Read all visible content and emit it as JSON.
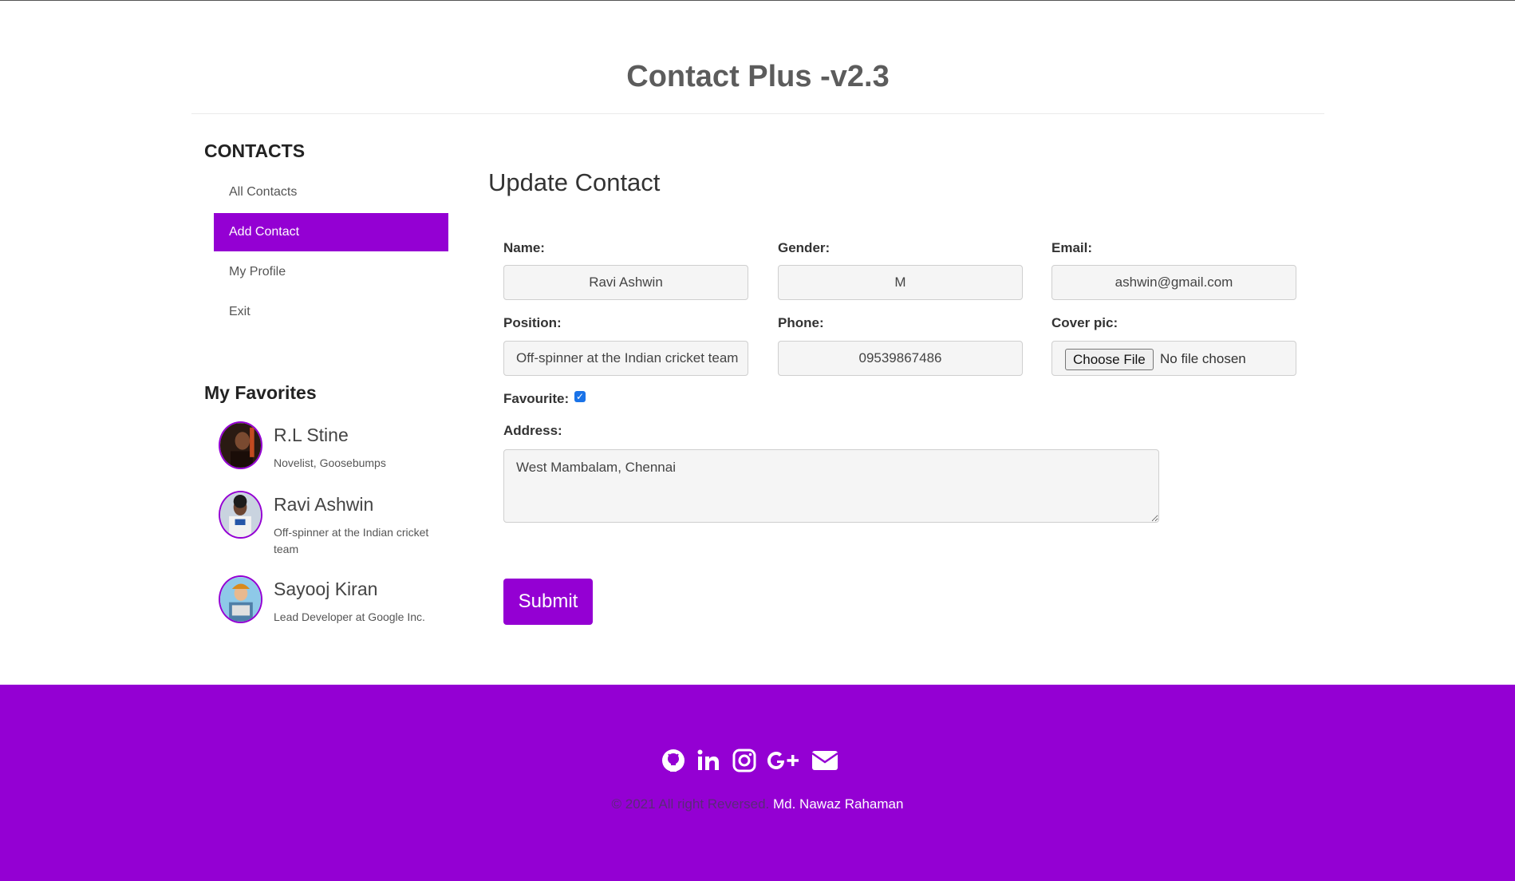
{
  "header": {
    "title": "Contact Plus -v2.3"
  },
  "sidebar": {
    "heading": "CONTACTS",
    "nav": [
      {
        "label": "All Contacts"
      },
      {
        "label": "Add Contact"
      },
      {
        "label": "My Profile"
      },
      {
        "label": "Exit"
      }
    ],
    "active_index": 1,
    "favorites_heading": "My Favorites",
    "favorites": [
      {
        "name": "R.L Stine",
        "subtitle": "Novelist, Goosebumps"
      },
      {
        "name": "Ravi Ashwin",
        "subtitle": "Off-spinner at the Indian cricket team"
      },
      {
        "name": "Sayooj Kiran",
        "subtitle": "Lead Developer at Google Inc."
      }
    ]
  },
  "form": {
    "title": "Update Contact",
    "name_label": "Name:",
    "name_value": "Ravi Ashwin",
    "gender_label": "Gender:",
    "gender_value": "M",
    "email_label": "Email:",
    "email_value": "ashwin@gmail.com",
    "position_label": "Position:",
    "position_value": "Off-spinner at the Indian cricket team",
    "phone_label": "Phone:",
    "phone_value": "09539867486",
    "cover_label": "Cover pic:",
    "cover_button": "Choose File",
    "cover_status": "No file chosen",
    "favourite_label": "Favourite:",
    "favourite_checked": true,
    "address_label": "Address:",
    "address_value": "West Mambalam, Chennai",
    "submit_label": "Submit"
  },
  "footer": {
    "social_icons": [
      "github-icon",
      "linkedin-icon",
      "instagram-icon",
      "google-plus-icon",
      "email-icon"
    ],
    "copyright": "© 2021 All right Reversed.",
    "author": "Md. Nawaz Rahaman"
  },
  "colors": {
    "accent": "#9400d3",
    "title": "#5c5c5c",
    "copyright_text": "#5b2a79"
  }
}
